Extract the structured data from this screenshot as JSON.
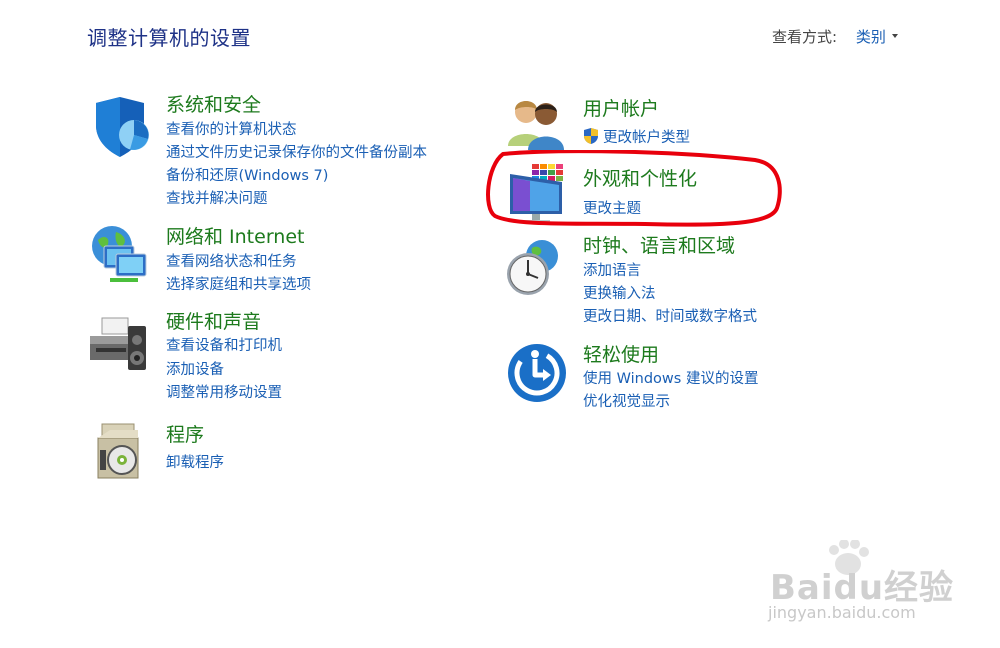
{
  "header": {
    "title": "调整计算机的设置",
    "view_by_label": "查看方式:",
    "view_by_value": "类别"
  },
  "left_column": [
    {
      "title": "系统和安全",
      "icon": "shield-pie-icon",
      "links": [
        "查看你的计算机状态",
        "通过文件历史记录保存你的文件备份副本",
        "备份和还原(Windows 7)",
        "查找并解决问题"
      ]
    },
    {
      "title": "网络和 Internet",
      "icon": "globe-monitors-icon",
      "links": [
        "查看网络状态和任务",
        "选择家庭组和共享选项"
      ]
    },
    {
      "title": "硬件和声音",
      "icon": "printer-speaker-icon",
      "links": [
        "查看设备和打印机",
        "添加设备",
        "调整常用移动设置"
      ]
    },
    {
      "title": "程序",
      "icon": "programs-disc-icon",
      "links": [
        "卸载程序"
      ]
    }
  ],
  "right_column": [
    {
      "title": "用户帐户",
      "icon": "users-icon",
      "links": [
        "更改帐户类型"
      ]
    },
    {
      "title": "外观和个性化",
      "icon": "monitor-palette-icon",
      "links": [
        "更改主题"
      ]
    },
    {
      "title": "时钟、语言和区域",
      "icon": "clock-globe-icon",
      "links": [
        "添加语言",
        "更换输入法",
        "更改日期、时间或数字格式"
      ]
    },
    {
      "title": "轻松使用",
      "icon": "ease-of-access-icon",
      "links": [
        "使用 Windows 建议的设置",
        "优化视觉显示"
      ]
    }
  ],
  "watermark": {
    "brand": "Baidu经验",
    "url": "jingyan.baidu.com"
  },
  "colors": {
    "title": "#1e3287",
    "category": "#1d7a1d",
    "link": "#1a5fb4",
    "highlight": "#e8000c"
  }
}
